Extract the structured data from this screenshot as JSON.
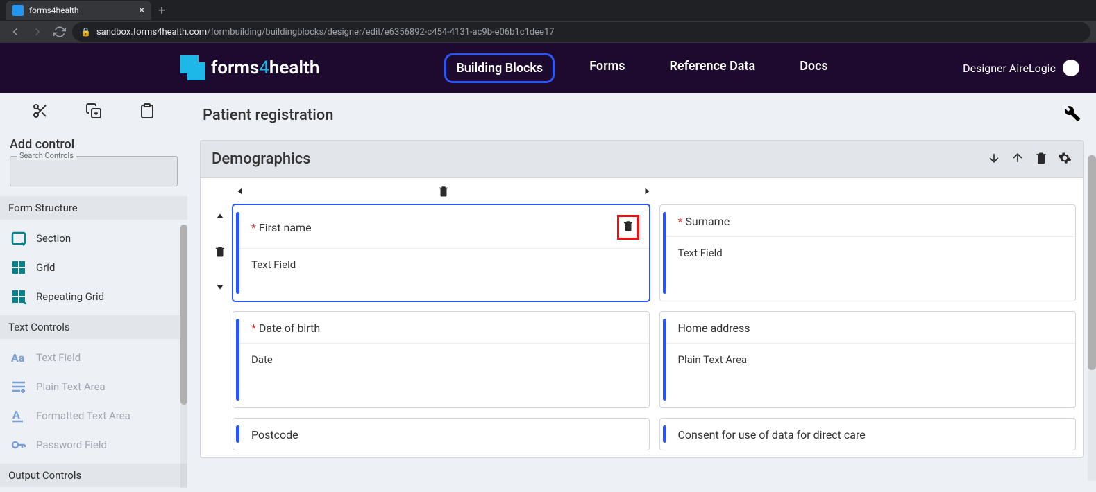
{
  "browser": {
    "tab_title": "forms4health",
    "url_host": "sandbox.forms4health.com",
    "url_path": "/formbuilding/buildingblocks/designer/edit/e6356892-c454-4131-ac9b-e06b1c1dee17"
  },
  "header": {
    "logo_a": "forms",
    "logo_b": "4",
    "logo_c": "health",
    "nav": {
      "building_blocks": "Building Blocks",
      "forms": "Forms",
      "reference_data": "Reference Data",
      "docs": "Docs"
    },
    "user": "Designer AireLogic"
  },
  "sidebar": {
    "add_control_title": "Add control",
    "search_label": "Search Controls",
    "groups": {
      "form_structure": {
        "title": "Form Structure",
        "items": {
          "section": "Section",
          "grid": "Grid",
          "repeating_grid": "Repeating Grid"
        }
      },
      "text_controls": {
        "title": "Text Controls",
        "items": {
          "text_field": "Text Field",
          "plain_text_area": "Plain Text Area",
          "formatted_text_area": "Formatted Text Area",
          "password_field": "Password Field"
        }
      },
      "output_controls": {
        "title": "Output Controls"
      }
    }
  },
  "canvas": {
    "title": "Patient registration",
    "section": {
      "title": "Demographics"
    },
    "fields": {
      "first_name": {
        "label": "First name",
        "type": "Text Field",
        "required": true
      },
      "surname": {
        "label": "Surname",
        "type": "Text Field",
        "required": true
      },
      "dob": {
        "label": "Date of birth",
        "type": "Date",
        "required": true
      },
      "home_address": {
        "label": "Home address",
        "type": "Plain Text Area",
        "required": false
      },
      "postcode": {
        "label": "Postcode",
        "type": "",
        "required": false
      },
      "consent": {
        "label": "Consent for use of data for direct care",
        "type": "",
        "required": false
      }
    }
  },
  "req_mark": "*"
}
